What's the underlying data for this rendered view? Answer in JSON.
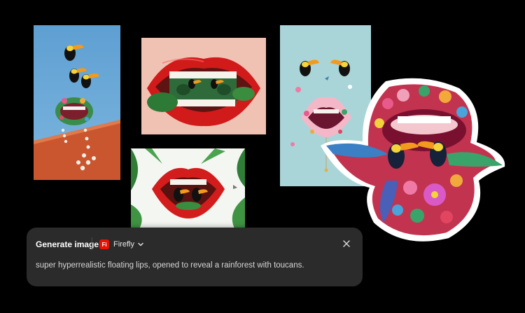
{
  "panel": {
    "title": "Generate image",
    "model_badge": "Fi",
    "model_name": "Firefly",
    "prompt": "super hyperrealistic floating lips, opened to reveal a rainforest with toucans."
  },
  "icons": {
    "model": "firefly-logo-icon",
    "dropdown": "chevron-down-icon",
    "close": "close-icon"
  },
  "colors": {
    "background": "#000000",
    "panel": "#2b2b2b",
    "firefly_red": "#eb1000"
  }
}
